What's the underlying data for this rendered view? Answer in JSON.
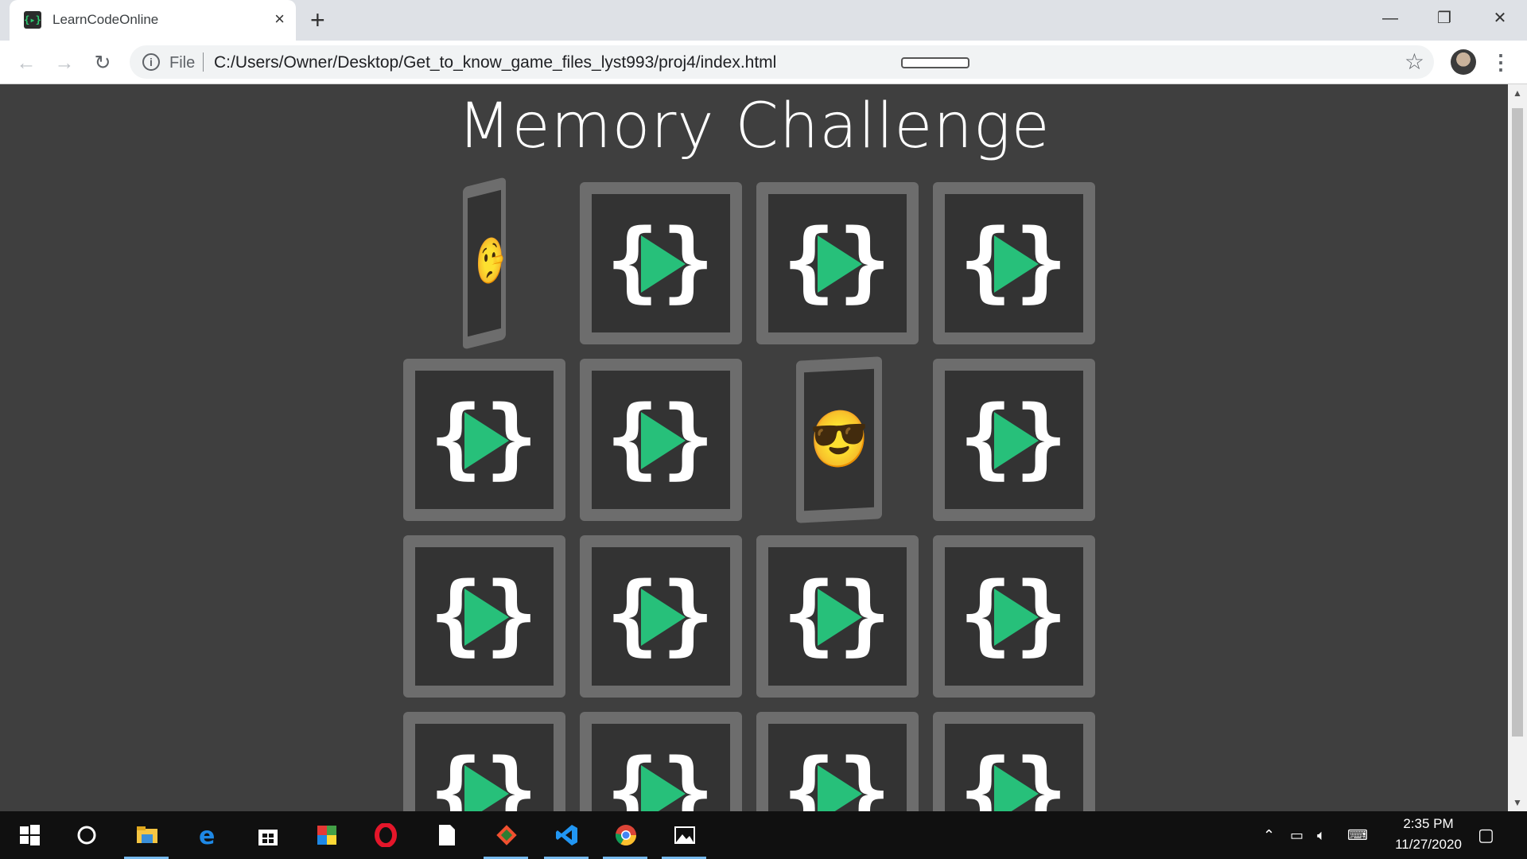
{
  "browser": {
    "tab_title": "LearnCodeOnline",
    "tab_close": "×",
    "new_tab": "+",
    "window_minimize": "—",
    "window_restore": "❐",
    "window_close": "✕",
    "scheme_label": "File",
    "url": "C:/Users/Owner/Desktop/Get_to_know_game_files_lyst993/proj4/index.html"
  },
  "page": {
    "title": "Memory Challenge",
    "cards": [
      {
        "state": "flipping",
        "emoji": "🤥"
      },
      {
        "state": "hidden"
      },
      {
        "state": "hidden"
      },
      {
        "state": "hidden"
      },
      {
        "state": "hidden"
      },
      {
        "state": "hidden"
      },
      {
        "state": "flipping",
        "emoji": "😎"
      },
      {
        "state": "hidden"
      },
      {
        "state": "hidden"
      },
      {
        "state": "hidden"
      },
      {
        "state": "hidden"
      },
      {
        "state": "hidden"
      },
      {
        "state": "hidden"
      },
      {
        "state": "hidden"
      },
      {
        "state": "hidden"
      },
      {
        "state": "hidden"
      }
    ],
    "card_back": {
      "left_brace": "{",
      "right_brace": "}",
      "accent_color": "#27c07a"
    }
  },
  "taskbar": {
    "apps": [
      "start-icon",
      "search-icon",
      "file-explorer-icon",
      "edge-icon",
      "store-icon",
      "office-icon",
      "opera-icon",
      "notepad-icon",
      "git-icon",
      "vscode-icon",
      "chrome-icon",
      "photos-icon"
    ],
    "time": "2:35 PM",
    "date": "11/27/2020"
  }
}
